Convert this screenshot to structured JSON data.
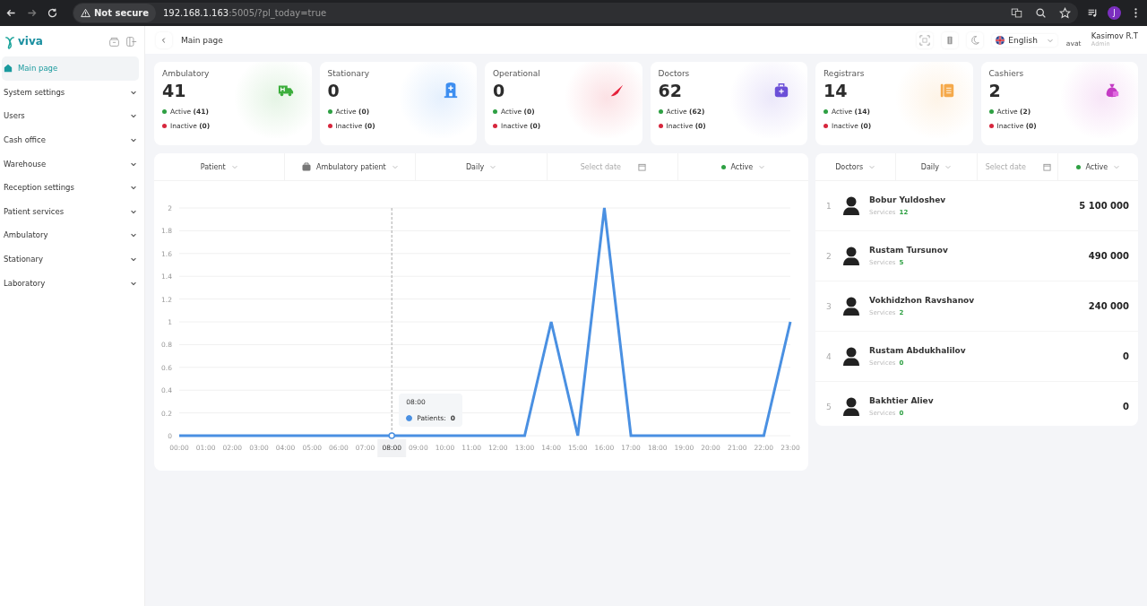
{
  "browser": {
    "security": "Not secure",
    "host": "192.168.1.163",
    "path": ":5005/?pl_today=true",
    "profile": "J"
  },
  "sidebar": {
    "logo": "viva",
    "items": [
      {
        "label": "Main page",
        "kind": "link",
        "selected": true
      },
      {
        "label": "System settings",
        "kind": "group",
        "selected": false,
        "expanded": false
      },
      {
        "label": "Users",
        "kind": "group",
        "selected": false,
        "expanded": false
      },
      {
        "label": "Cash office",
        "kind": "group",
        "selected": false,
        "expanded": false
      },
      {
        "label": "Warehouse",
        "kind": "group",
        "selected": false,
        "expanded": false
      },
      {
        "label": "Reception settings",
        "kind": "group",
        "selected": false,
        "expanded": false
      },
      {
        "label": "Patient services",
        "kind": "group",
        "selected": false,
        "expanded": false
      },
      {
        "label": "Ambulatory",
        "kind": "group",
        "selected": false,
        "expanded": false
      },
      {
        "label": "Stationary",
        "kind": "group",
        "selected": false,
        "expanded": false
      },
      {
        "label": "Laboratory",
        "kind": "group",
        "selected": false,
        "expanded": false
      }
    ]
  },
  "header": {
    "title": "Main page",
    "language": "English",
    "avatar_alt": "avat",
    "user": "Kasimov R.T",
    "role": "Admin"
  },
  "stats": [
    {
      "title": "Ambulatory",
      "count": "41",
      "active": "Active",
      "active_count": "(41)",
      "inactive": "Inactive",
      "inactive_count": "(0)",
      "color": "#3cae3c"
    },
    {
      "title": "Stationary",
      "count": "0",
      "active": "Active",
      "active_count": "(0)",
      "inactive": "Inactive",
      "inactive_count": "(0)",
      "color": "#3d8ef0"
    },
    {
      "title": "Operational",
      "count": "0",
      "active": "Active",
      "active_count": "(0)",
      "inactive": "Inactive",
      "inactive_count": "(0)",
      "color": "#e5213a"
    },
    {
      "title": "Doctors",
      "count": "62",
      "active": "Active",
      "active_count": "(62)",
      "inactive": "Inactive",
      "inactive_count": "(0)",
      "color": "#6b4fd8"
    },
    {
      "title": "Registrars",
      "count": "14",
      "active": "Active",
      "active_count": "(14)",
      "inactive": "Inactive",
      "inactive_count": "(0)",
      "color": "#f5a94a"
    },
    {
      "title": "Cashiers",
      "count": "2",
      "active": "Active",
      "active_count": "(2)",
      "inactive": "Inactive",
      "inactive_count": "(0)",
      "color": "#c43bc4"
    }
  ],
  "patients_chart": {
    "filters": [
      {
        "label": "Patient",
        "kind": "dropdown"
      },
      {
        "label": "Ambulatory patient",
        "kind": "bag-dropdown"
      },
      {
        "label": "Daily",
        "kind": "dropdown"
      },
      {
        "placeholder": "Select date",
        "kind": "date"
      },
      {
        "label": "Active",
        "kind": "status-dropdown"
      }
    ],
    "tooltip": {
      "title": "08:00",
      "separator": ":",
      "value": "0"
    },
    "chart_data": {
      "type": "line",
      "categories": [
        "00:00",
        "01:00",
        "02:00",
        "03:00",
        "04:00",
        "05:00",
        "06:00",
        "07:00",
        "08:00",
        "09:00",
        "10:00",
        "11:00",
        "12:00",
        "13:00",
        "14:00",
        "15:00",
        "16:00",
        "17:00",
        "18:00",
        "19:00",
        "20:00",
        "21:00",
        "22:00",
        "23:00"
      ],
      "series": [
        {
          "name": "Patients",
          "color": "#4a90e2",
          "values": [
            0,
            0,
            0,
            0,
            0,
            0,
            0,
            0,
            0,
            0,
            0,
            0,
            0,
            0,
            1,
            0,
            2,
            0,
            0,
            0,
            0,
            0,
            0,
            1
          ]
        }
      ],
      "grid": true,
      "ref_lines": [
        {
          "axis": "x",
          "value": "08:00"
        }
      ],
      "ylim": [
        0,
        2
      ],
      "yticks": [
        {
          "value": 0,
          "label": "0"
        },
        {
          "value": 0.2,
          "label": "0.2"
        },
        {
          "value": 0.4,
          "label": "0.4"
        },
        {
          "value": 0.6,
          "label": "0.6"
        },
        {
          "value": 0.8,
          "label": "0.8"
        },
        {
          "value": 1,
          "label": "1"
        },
        {
          "value": 1.2,
          "label": "1.2"
        },
        {
          "value": 1.4,
          "label": "1.4"
        },
        {
          "value": 1.6,
          "label": "1.6"
        },
        {
          "value": 1.8,
          "label": "1.8"
        },
        {
          "value": 2,
          "label": "2"
        }
      ]
    }
  },
  "doctors": {
    "filters": [
      {
        "label": "Doctors",
        "kind": "dropdown"
      },
      {
        "label": "Daily",
        "kind": "dropdown"
      },
      {
        "placeholder": "Select date",
        "kind": "date"
      },
      {
        "label": "Active",
        "kind": "status-dropdown"
      }
    ],
    "rows": [
      {
        "rank": "1",
        "name": "Bobur Yuldoshev",
        "services_label": "Services",
        "services": "12",
        "amount": "5 100 000"
      },
      {
        "rank": "2",
        "name": "Rustam Tursunov",
        "services_label": "Services",
        "services": "5",
        "amount": "490 000"
      },
      {
        "rank": "3",
        "name": "Vokhidzhon Ravshanov",
        "services_label": "Services",
        "services": "2",
        "amount": "240 000"
      },
      {
        "rank": "4",
        "name": "Rustam Abdukhalilov",
        "services_label": "Services",
        "services": "0",
        "amount": "0"
      },
      {
        "rank": "5",
        "name": "Bakhtier Aliev",
        "services_label": "Services",
        "services": "0",
        "amount": "0"
      }
    ]
  }
}
